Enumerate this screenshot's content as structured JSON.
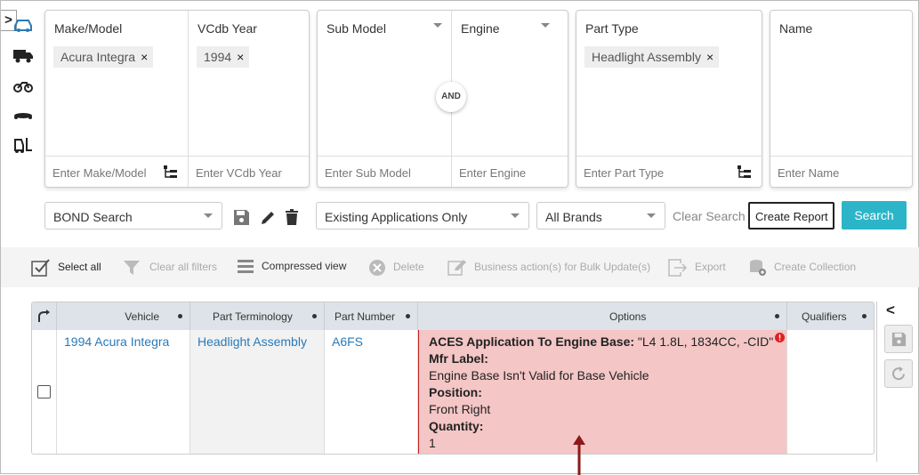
{
  "sidebar": {
    "toggle": ">",
    "icons": [
      "car-icon",
      "truck-icon",
      "motorcycle-icon",
      "snowmobile-icon",
      "forklift-icon"
    ],
    "accent": "#2a7ab8"
  },
  "filters": {
    "make_model": {
      "title": "Make/Model",
      "chip": "Acura Integra",
      "placeholder": "Enter Make/Model"
    },
    "vcdb_year": {
      "title": "VCdb Year",
      "chip": "1994",
      "placeholder": "Enter VCdb Year"
    },
    "sub_model": {
      "title": "Sub Model",
      "placeholder": "Enter Sub Model"
    },
    "engine": {
      "title": "Engine",
      "placeholder": "Enter Engine"
    },
    "and_label": "AND",
    "part_type": {
      "title": "Part Type",
      "chip": "Headlight Assembly",
      "placeholder": "Enter Part Type"
    },
    "name": {
      "title": "Name",
      "placeholder": "Enter Name"
    },
    "chip_remove": "×"
  },
  "search_row": {
    "bond_search": "BOND Search",
    "applications": "Existing Applications Only",
    "brands": "All Brands",
    "clear_search": "Clear Search",
    "create_report": "Create Report",
    "search": "Search",
    "search_color": "#2cb5c9"
  },
  "toolbar": {
    "select_all": "Select all",
    "clear_filters": "Clear all filters",
    "compressed_view": "Compressed view",
    "delete": "Delete",
    "business_action": "Business action(s) for Bulk Update(s)",
    "export": "Export",
    "create_collection": "Create Collection"
  },
  "grid": {
    "headers": {
      "vehicle": "Vehicle",
      "part_terminology": "Part Terminology",
      "part_number": "Part Number",
      "options": "Options",
      "qualifiers": "Qualifiers"
    },
    "row": {
      "vehicle": "1994 Acura Integra",
      "part_terminology": "Headlight Assembly",
      "part_number": "A6FS",
      "options": {
        "engine_base_label": "ACES Application To Engine Base:",
        "engine_base_value": " \"L4 1.8L, 1834CC, -CID\"",
        "mfr_label": "Mfr Label:",
        "mfr_value": "Engine Base Isn't Valid for Base Vehicle",
        "position_label": "Position:",
        "position_value": "Front Right",
        "quantity_label": "Quantity:",
        "quantity_value": "1"
      },
      "error_color": "#e02020"
    }
  },
  "right_panel": {
    "collapse": "<"
  }
}
